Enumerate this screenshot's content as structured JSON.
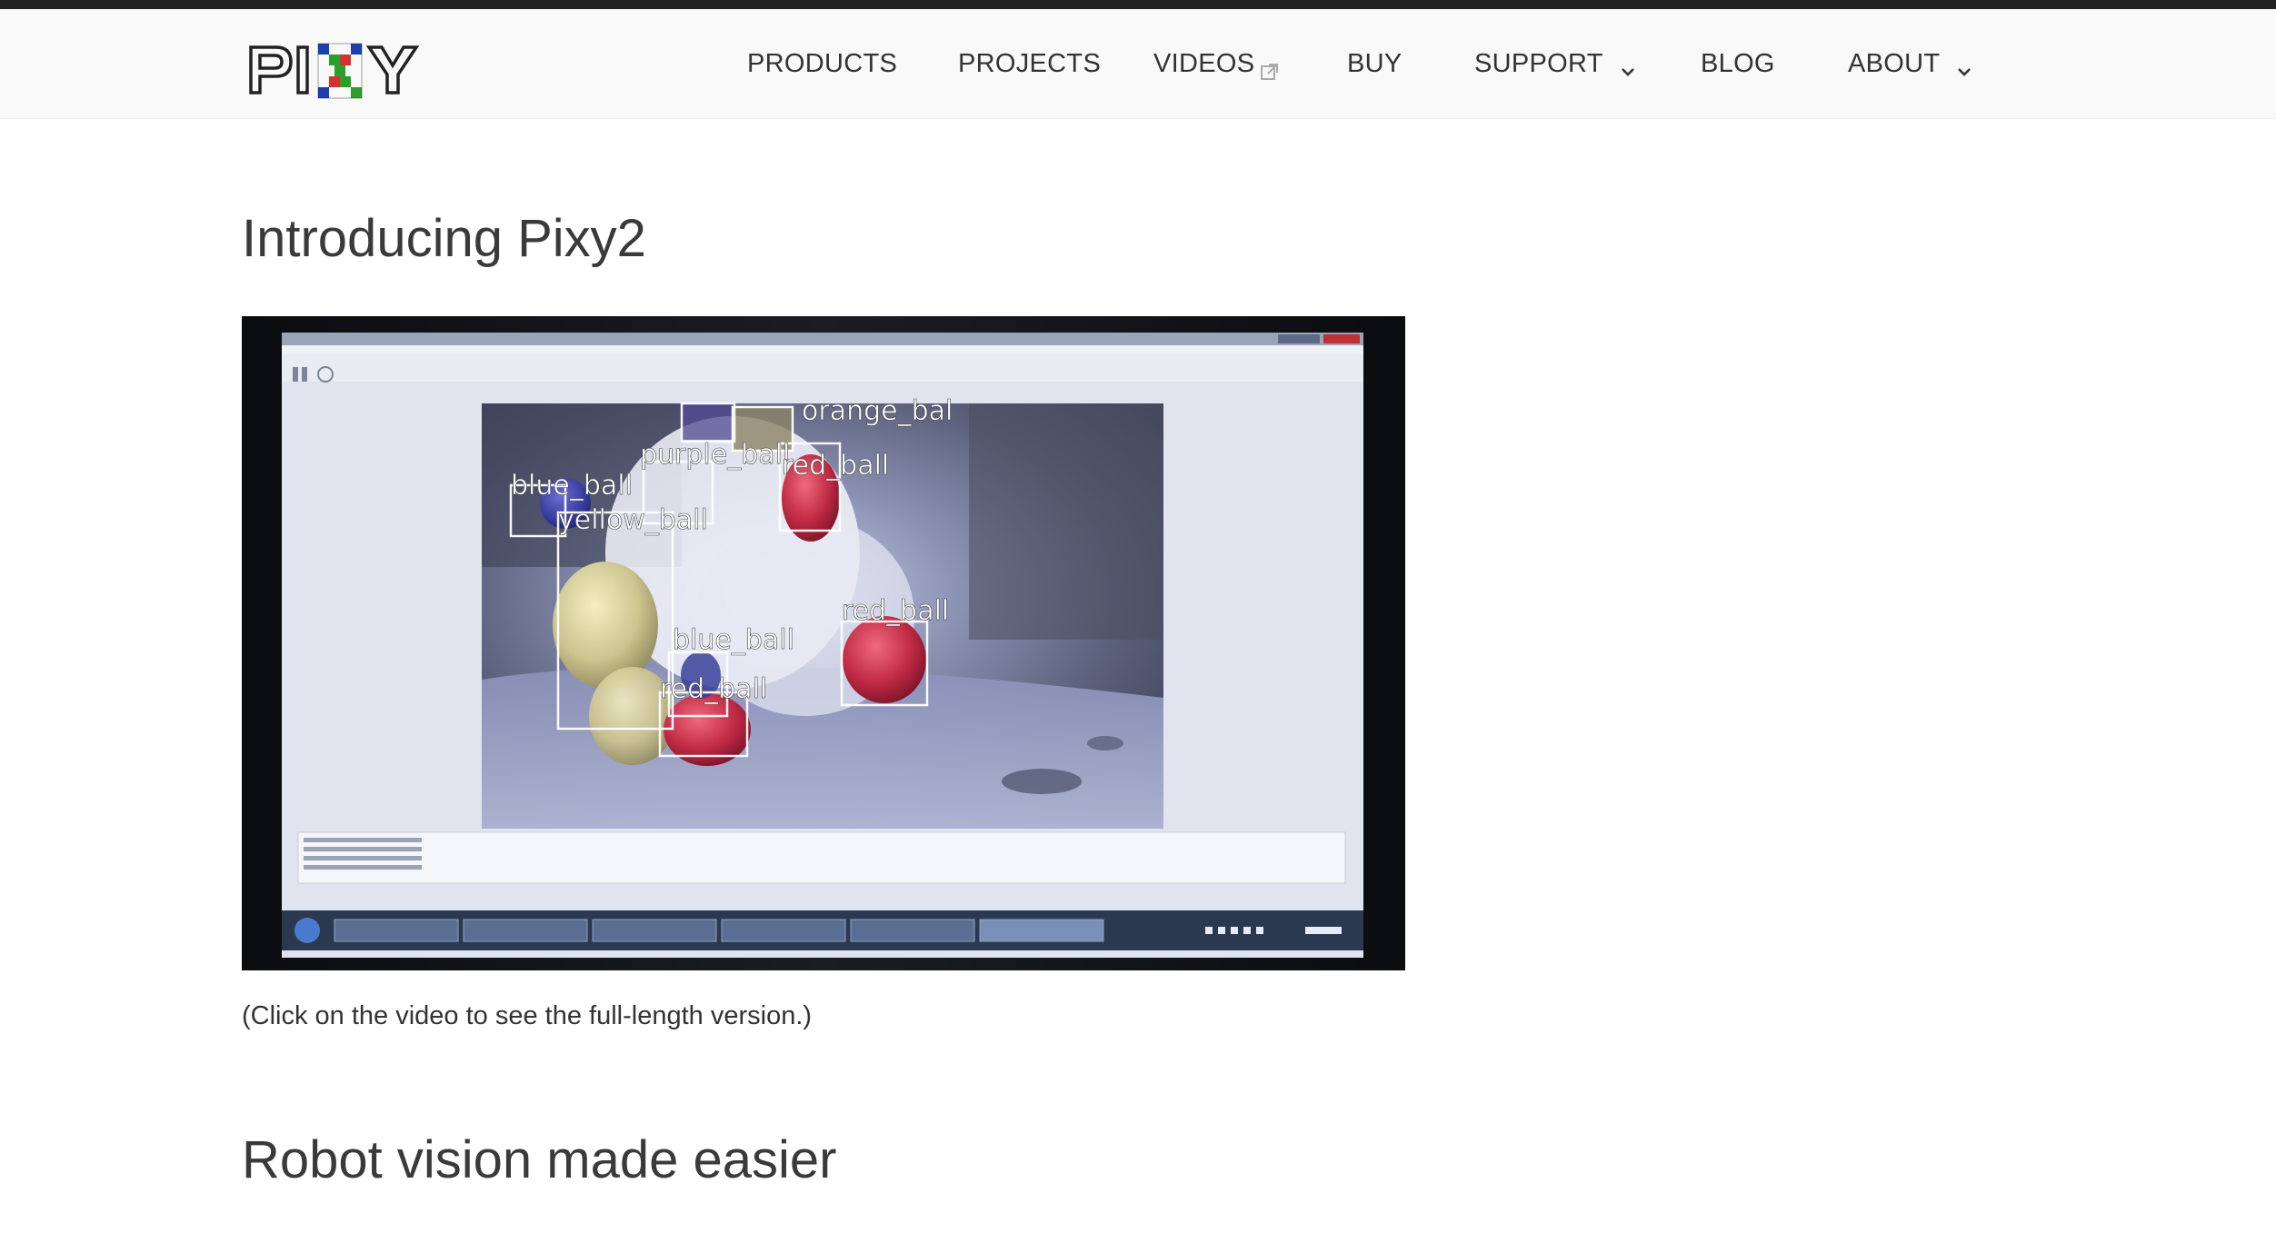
{
  "brand": {
    "logo_text": "PIXY"
  },
  "nav": {
    "items": [
      {
        "label": "PRODUCTS"
      },
      {
        "label": "PROJECTS"
      },
      {
        "label": "VIDEOS",
        "icon": "external-link-icon"
      },
      {
        "label": "BUY"
      },
      {
        "label": "SUPPORT",
        "icon": "chevron-down-icon"
      },
      {
        "label": "BLOG"
      },
      {
        "label": "ABOUT",
        "icon": "chevron-down-icon"
      }
    ]
  },
  "main": {
    "intro_heading": "Introducing Pixy2",
    "video_caption": "(Click on the video to see the full-length version.)",
    "robot_heading": "Robot vision made easier"
  },
  "video": {
    "detections": [
      {
        "label": "orange_bal"
      },
      {
        "label": "purple_ball"
      },
      {
        "label": "red_ball"
      },
      {
        "label": "blue_ball"
      },
      {
        "label": "yellow_ball"
      },
      {
        "label": "red_ball"
      },
      {
        "label": "blue_ball"
      },
      {
        "label": "red_ball"
      }
    ]
  },
  "colors": {
    "top_bar": "#222222",
    "header_bg": "#f9f9f9",
    "text": "#333333"
  }
}
